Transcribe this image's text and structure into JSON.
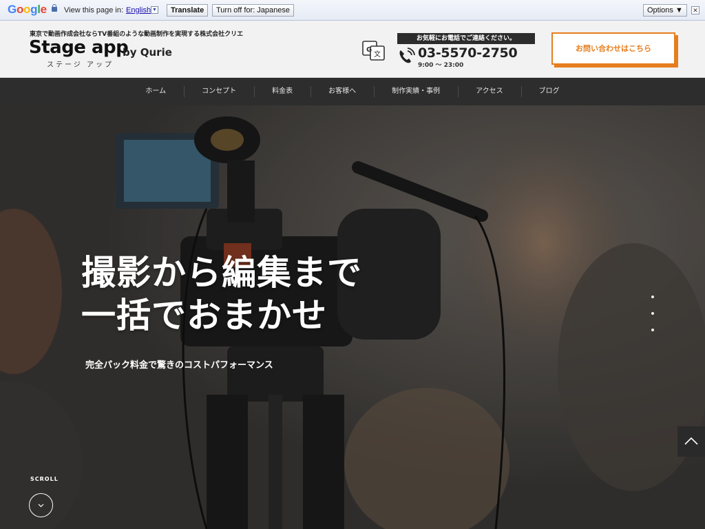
{
  "translate_bar": {
    "logo_letters": [
      {
        "ch": "G",
        "color": "#4285f4"
      },
      {
        "ch": "o",
        "color": "#ea4335"
      },
      {
        "ch": "o",
        "color": "#fbbc05"
      },
      {
        "ch": "g",
        "color": "#4285f4"
      },
      {
        "ch": "l",
        "color": "#34a853"
      },
      {
        "ch": "e",
        "color": "#ea4335"
      }
    ],
    "view_text": "View this page in:",
    "language": "English",
    "translate_label": "Translate",
    "turn_off_label": "Turn off for: Japanese",
    "options_label": "Options ▼",
    "close_label": "✕"
  },
  "header": {
    "tagline": "東京で動画作成会社ならTV番組のような動画制作を実現する株式会社クリエ",
    "logo_main": "Stage app",
    "logo_sub": "by Qurie",
    "logo_kana": "ステージ アップ",
    "phone_badge": "お気軽にお電話でご連絡ください。",
    "phone_number": "03-5570-2750",
    "phone_hours": "9:00 〜 23:00",
    "contact_label": "お問い合わせはこちら",
    "accent_color": "#e67e1e"
  },
  "nav": {
    "items": [
      "ホーム",
      "コンセプト",
      "料金表",
      "お客様へ",
      "制作実績・事例",
      "アクセス",
      "ブログ"
    ]
  },
  "hero": {
    "title": "撮影から編集まで\n一括でおまかせ",
    "subtitle": "完全パック料金で驚きのコストパフォーマンス",
    "scroll_label": "SCROLL",
    "slide_count": 3
  }
}
